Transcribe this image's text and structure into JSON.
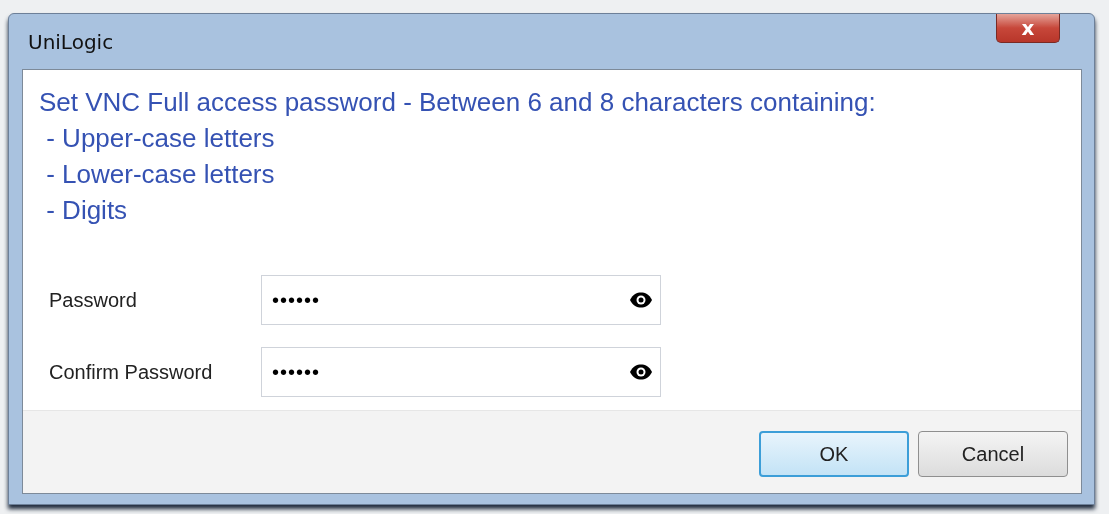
{
  "window": {
    "title": "UniLogic",
    "close": "x"
  },
  "instructions": [
    "Set VNC Full access password - Between 6 and 8 characters containing:",
    " - Upper-case letters",
    " - Lower-case letters",
    " - Digits"
  ],
  "fields": [
    {
      "label": "Password",
      "value": "••••••"
    },
    {
      "label": "Confirm Password",
      "value": "••••••"
    }
  ],
  "buttons": [
    {
      "label": "OK",
      "selected": true
    },
    {
      "label": "Cancel",
      "selected": false
    }
  ]
}
